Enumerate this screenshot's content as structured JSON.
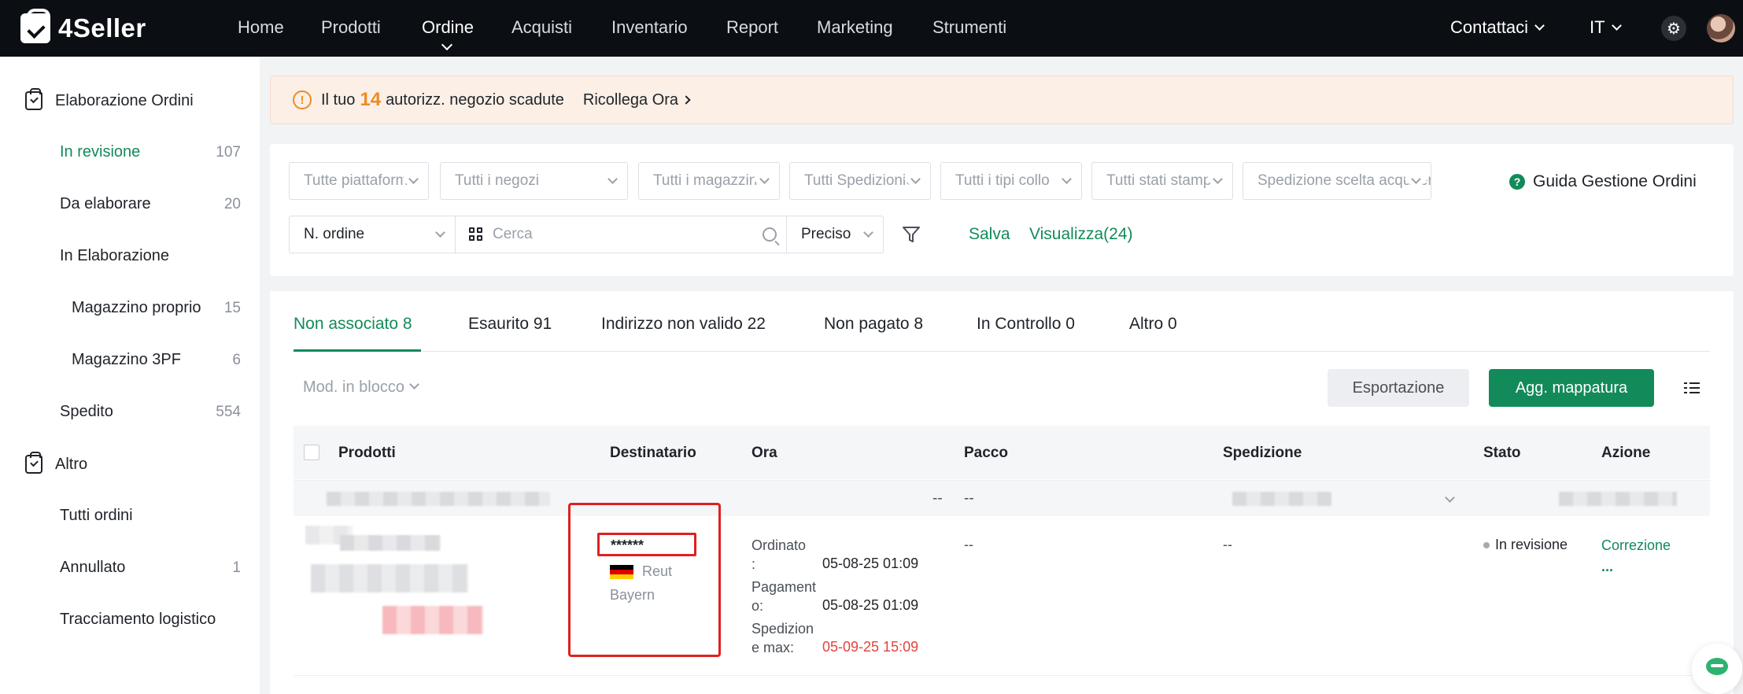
{
  "app": {
    "name": "4Seller"
  },
  "nav": {
    "items": [
      "Home",
      "Prodotti",
      "Ordine",
      "Acquisti",
      "Inventario",
      "Report",
      "Marketing",
      "Strumenti"
    ],
    "active": "Ordine",
    "contact": "Contattaci",
    "language": "IT"
  },
  "sidebar": {
    "group1": "Elaborazione Ordini",
    "items": [
      {
        "label": "In revisione",
        "count": "107"
      },
      {
        "label": "Da elaborare",
        "count": "20"
      },
      {
        "label": "In Elaborazione",
        "count": ""
      },
      {
        "label": "Magazzino proprio",
        "count": "15"
      },
      {
        "label": "Magazzino 3PF",
        "count": "6"
      },
      {
        "label": "Spedito",
        "count": "554"
      }
    ],
    "group2": "Altro",
    "other": [
      {
        "label": "Tutti ordini",
        "count": ""
      },
      {
        "label": "Annullato",
        "count": "1"
      },
      {
        "label": "Tracciamento logistico",
        "count": ""
      }
    ]
  },
  "banner": {
    "prefix": "Il tuo",
    "count": "14",
    "suffix": "autorizz. negozio scadute",
    "action": "Ricollega Ora"
  },
  "filters": {
    "platform": "Tutte piattaforme",
    "shops": "Tutti i negozi",
    "warehouses": "Tutti i magazzini",
    "shipping": "Tutti Spedizionieri",
    "package_types": "Tutti i tipi collo",
    "print_status": "Tutti stati stampa",
    "shipping_choice": "Spedizione scelta acquirente",
    "guide": "Guida Gestione Ordini",
    "search_field": "N. ordine",
    "search_placeholder": "Cerca",
    "match": "Preciso",
    "save": "Salva",
    "view": "Visualizza(24)"
  },
  "tabs": [
    "Non associato 8",
    "Esaurito 91",
    "Indirizzo non valido 22",
    "Non pagato 8",
    "In Controllo 0",
    "Altro 0"
  ],
  "toolbar": {
    "bulk": "Mod. in blocco",
    "export": "Esportazione",
    "add_mapping": "Agg. mappatura"
  },
  "table": {
    "columns": [
      "Prodotti",
      "Destinatario",
      "Ora",
      "Pacco",
      "Spedizione",
      "Stato",
      "Azione"
    ],
    "group_row": {
      "time_dash": "--",
      "package_dash": "--",
      "badge": "T"
    },
    "row": {
      "recipient_name": "******",
      "recipient_city": "Reut",
      "recipient_state": "Bayern",
      "ordered_label": "Ordinato",
      "ordered_colon": ":",
      "ordered_value": "05-08-25 01:09",
      "paid_label_1": "Pagament",
      "paid_label_2": "o:",
      "paid_value": "05-08-25 01:09",
      "ship_label_1": "Spedizion",
      "ship_label_2": "e max:",
      "ship_value": "05-09-25 15:09",
      "package": "--",
      "shipping": "--",
      "status": "In revisione",
      "action": "Correzione",
      "more": "..."
    }
  },
  "colors": {
    "accent": "#138a5a",
    "warning": "#f08a24",
    "deadline": "#e4433b",
    "highlight_box": "#e02020"
  }
}
